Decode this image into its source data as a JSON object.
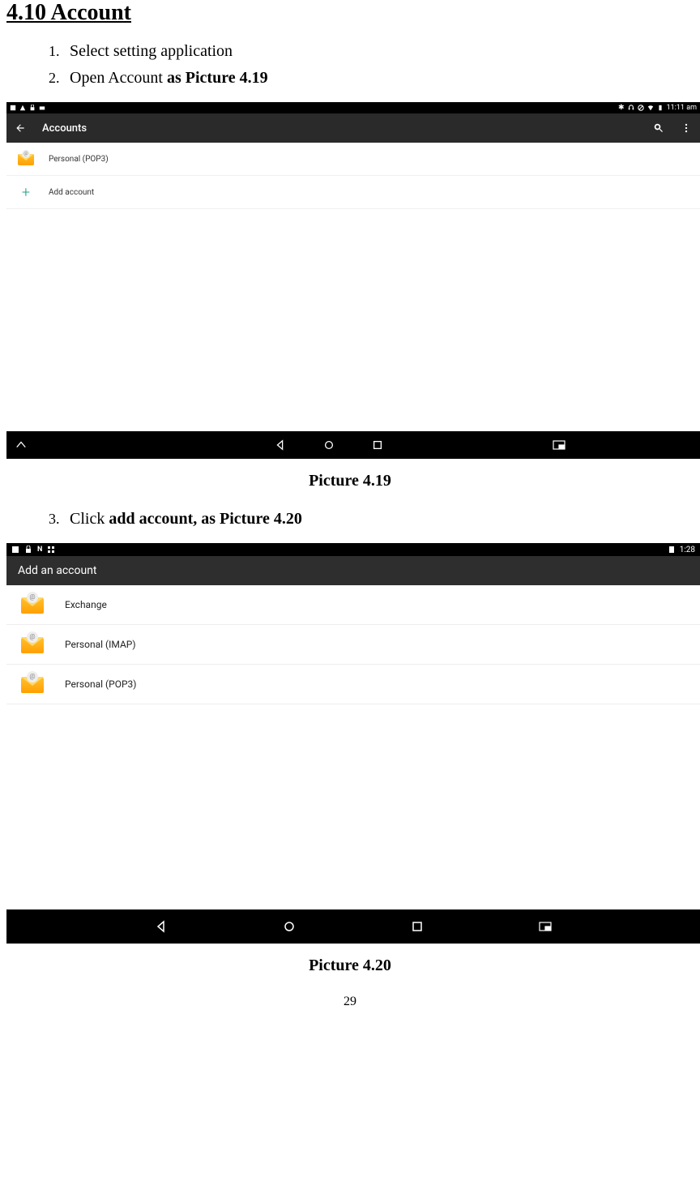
{
  "heading": "4.10 Account",
  "steps_a": [
    {
      "n": "1.",
      "text": "Select setting application",
      "bold": ""
    },
    {
      "n": "2.",
      "text": "Open Account ",
      "bold": "as Picture 4.19"
    }
  ],
  "caption_a": "Picture 4.19",
  "steps_b": [
    {
      "n": "3.",
      "text": "Click ",
      "bold": "add account, as Picture 4.20"
    }
  ],
  "caption_b": "Picture 4.20",
  "page_number": "29",
  "shot_a": {
    "status_time": "11:11 am",
    "appbar_title": "Accounts",
    "items": [
      {
        "label": "Personal (POP3)"
      },
      {
        "label": "Add account"
      }
    ]
  },
  "shot_b": {
    "status_time": "1:28",
    "appbar_title": "Add an account",
    "items": [
      {
        "label": "Exchange"
      },
      {
        "label": "Personal (IMAP)"
      },
      {
        "label": "Personal (POP3)"
      }
    ]
  }
}
